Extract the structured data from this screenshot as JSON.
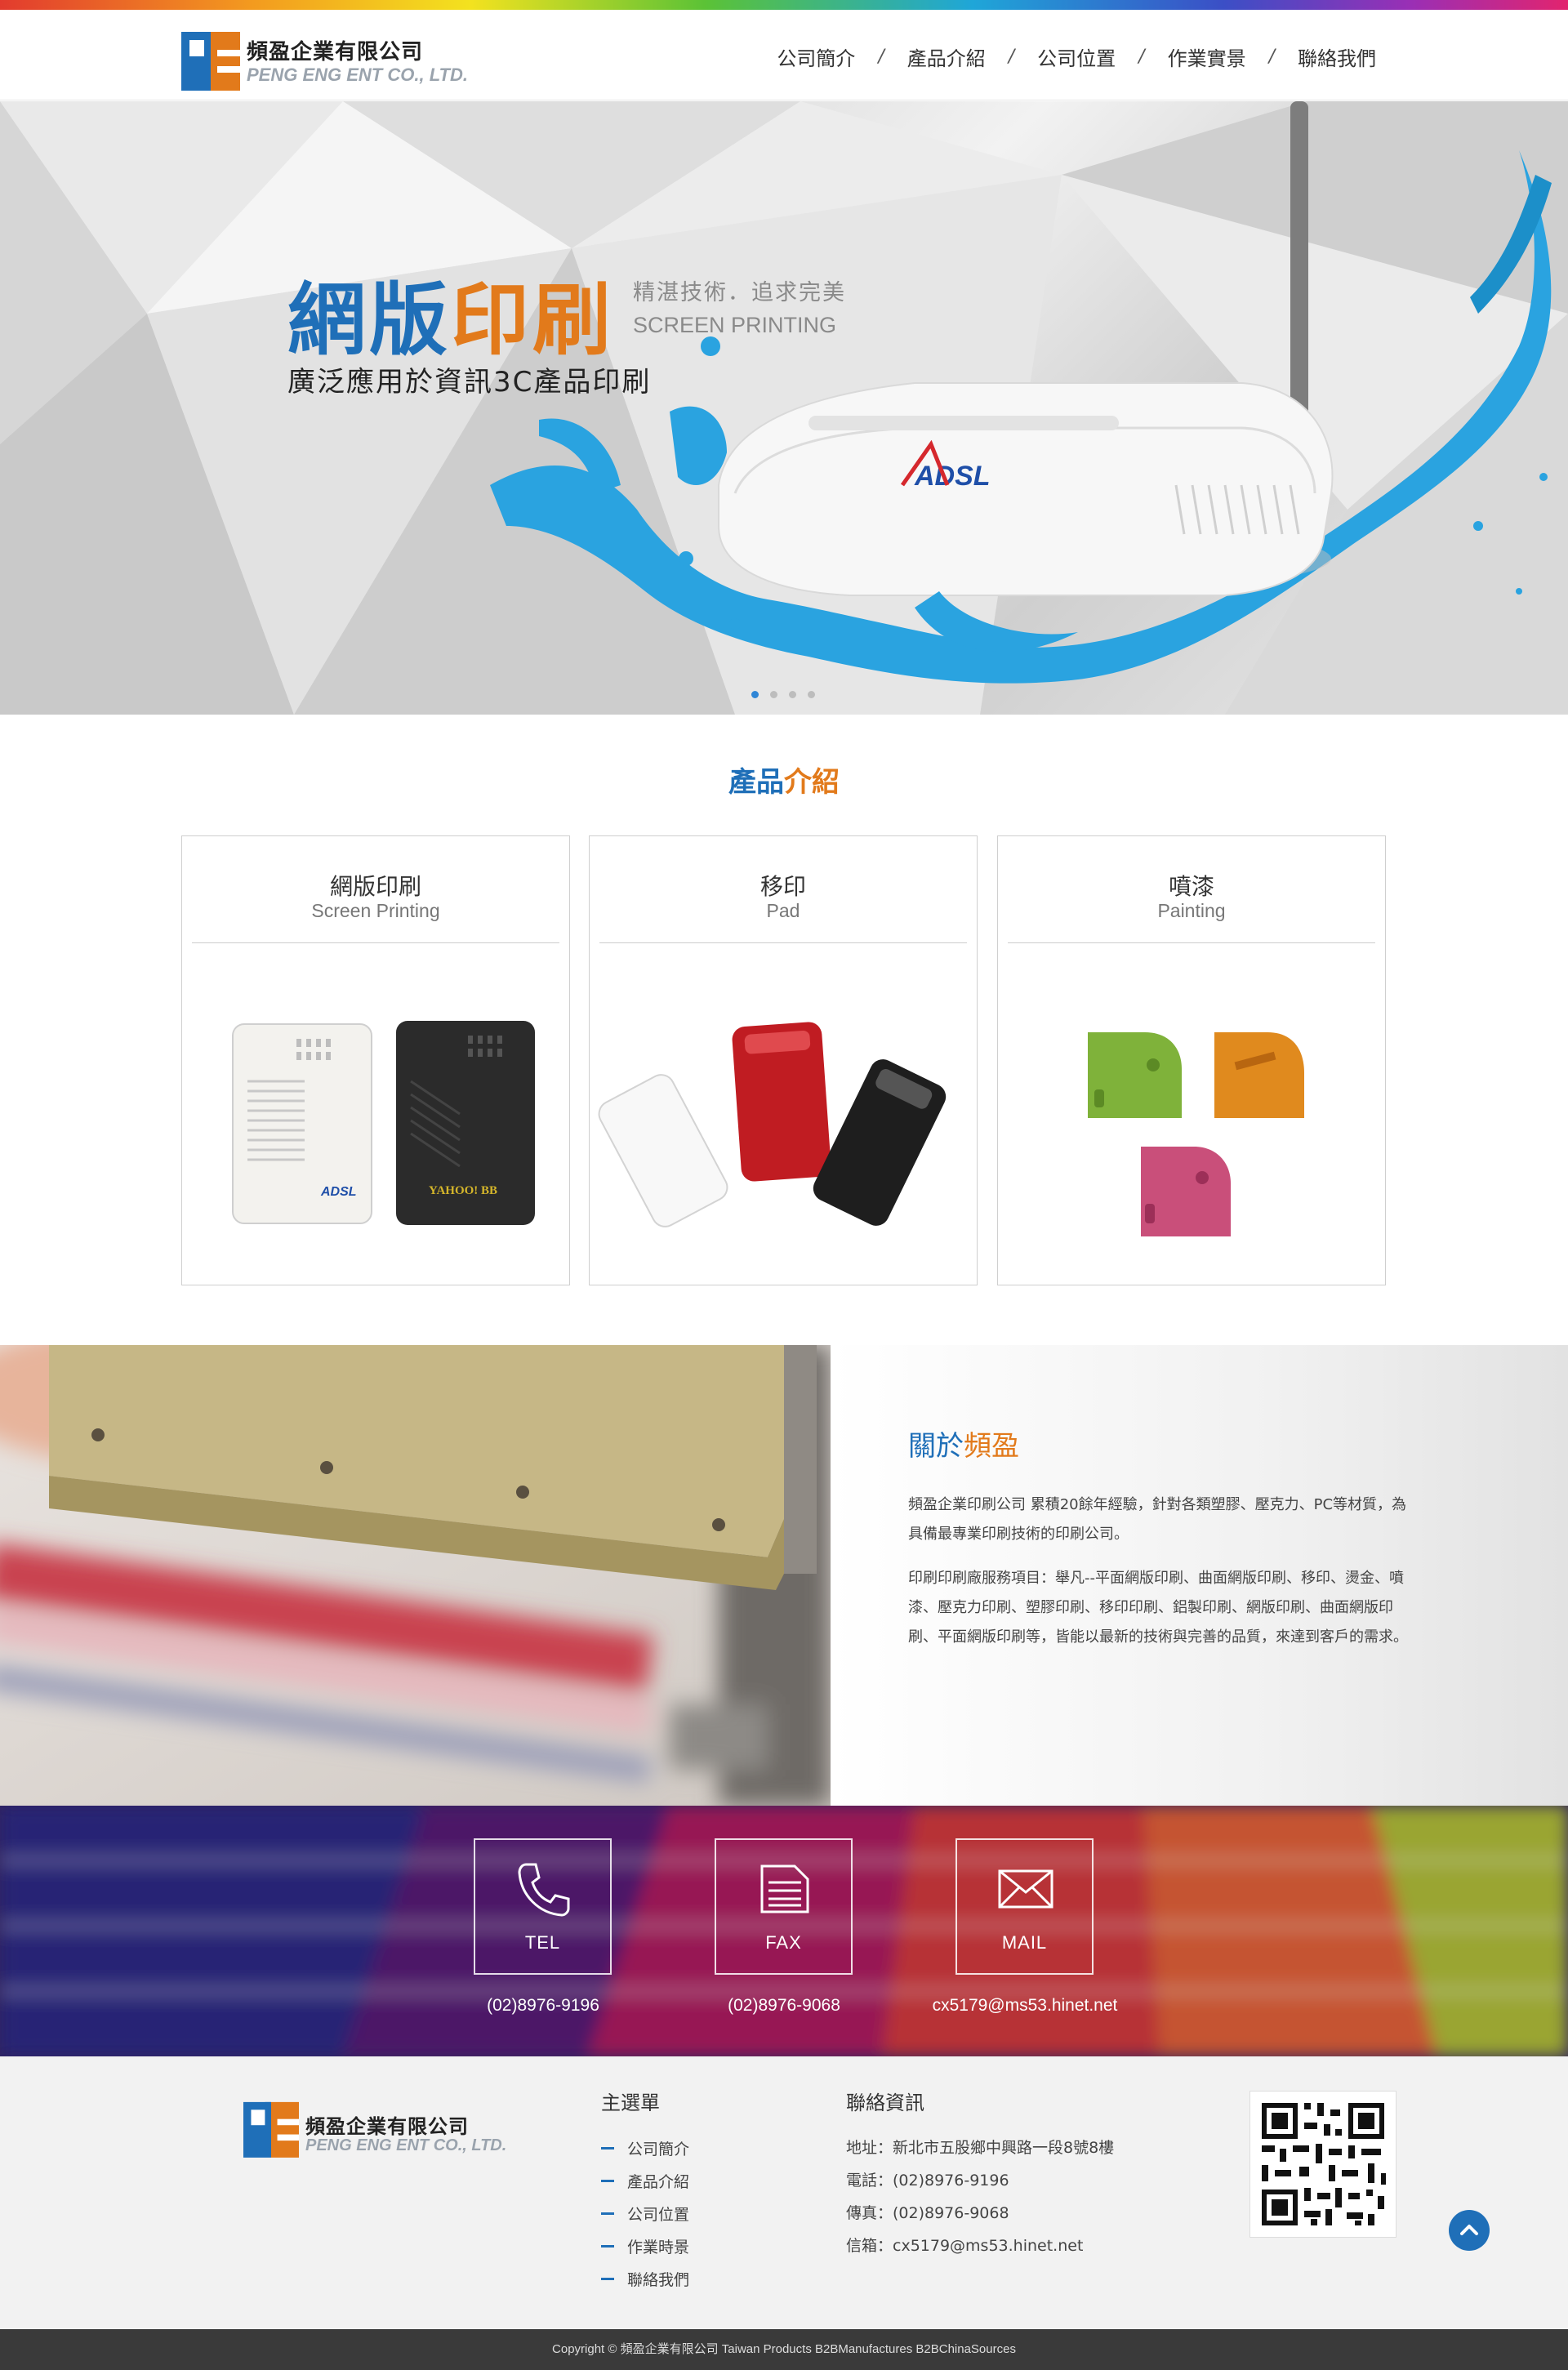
{
  "header": {
    "logo_cn": "頻盈企業有限公司",
    "logo_en": "PENG ENG ENT CO., LTD.",
    "nav": [
      {
        "label": "公司簡介"
      },
      {
        "label": "產品介紹"
      },
      {
        "label": "公司位置"
      },
      {
        "label": "作業實景"
      },
      {
        "label": "聯絡我們"
      }
    ],
    "nav_separator": "/"
  },
  "hero": {
    "title_part1": "網版",
    "title_part2": "印刷",
    "side_cn": "精湛技術．追求完美",
    "side_en": "SCREEN PRINTING",
    "subtitle": "廣泛應用於資訊3C產品印刷",
    "product_badge": "ADSL",
    "slides_count": 4,
    "active_slide": 1
  },
  "products": {
    "title_part1": "產品",
    "title_part2": "介紹",
    "cards": [
      {
        "cn": "網版印刷",
        "en": "Screen Printing",
        "device_labels": [
          "ADSL",
          "YAHOO! BB"
        ]
      },
      {
        "cn": "移印",
        "en": "Pad"
      },
      {
        "cn": "噴漆",
        "en": "Painting"
      }
    ]
  },
  "about": {
    "title_part1": "關於",
    "title_part2": "頻盈",
    "paragraph1": "頻盈企業印刷公司 累積20餘年經驗，針對各類塑膠、壓克力、PC等材質，為具備最專業印刷技術的印刷公司。",
    "paragraph2": "印刷印刷廠服務項目：舉凡--平面網版印刷、曲面網版印刷、移印、燙金、噴漆、壓克力印刷、塑膠印刷、移印印刷、鋁製印刷、網版印刷、曲面網版印刷、平面網版印刷等，皆能以最新的技術與完善的品質，來達到客戶的需求。"
  },
  "contact": {
    "items": [
      {
        "label": "TEL",
        "value": "(02)8976-9196",
        "icon": "phone-icon"
      },
      {
        "label": "FAX",
        "value": "(02)8976-9068",
        "icon": "fax-icon"
      },
      {
        "label": "MAIL",
        "value": "cx5179@ms53.hinet.net",
        "icon": "mail-icon"
      }
    ]
  },
  "footer": {
    "logo_cn": "頻盈企業有限公司",
    "logo_en": "PENG ENG ENT CO., LTD.",
    "menu_title": "主選單",
    "menu": [
      "公司簡介",
      "產品介紹",
      "公司位置",
      "作業時景",
      "聯絡我們"
    ],
    "info_title": "聯絡資訊",
    "info": [
      "地址：新北市五股鄉中興路一段8號8樓",
      "電話：(02)8976-9196",
      "傳真：(02)8976-9068",
      "信箱：cx5179@ms53.hinet.net"
    ],
    "copyright": "Copyright © 頻盈企業有限公司 Taiwan Products B2BManufactures B2BChinaSources"
  },
  "colors": {
    "brand_blue": "#1f6fb8",
    "brand_orange": "#e27a1b",
    "paint_blue": "#2aa3e0"
  }
}
